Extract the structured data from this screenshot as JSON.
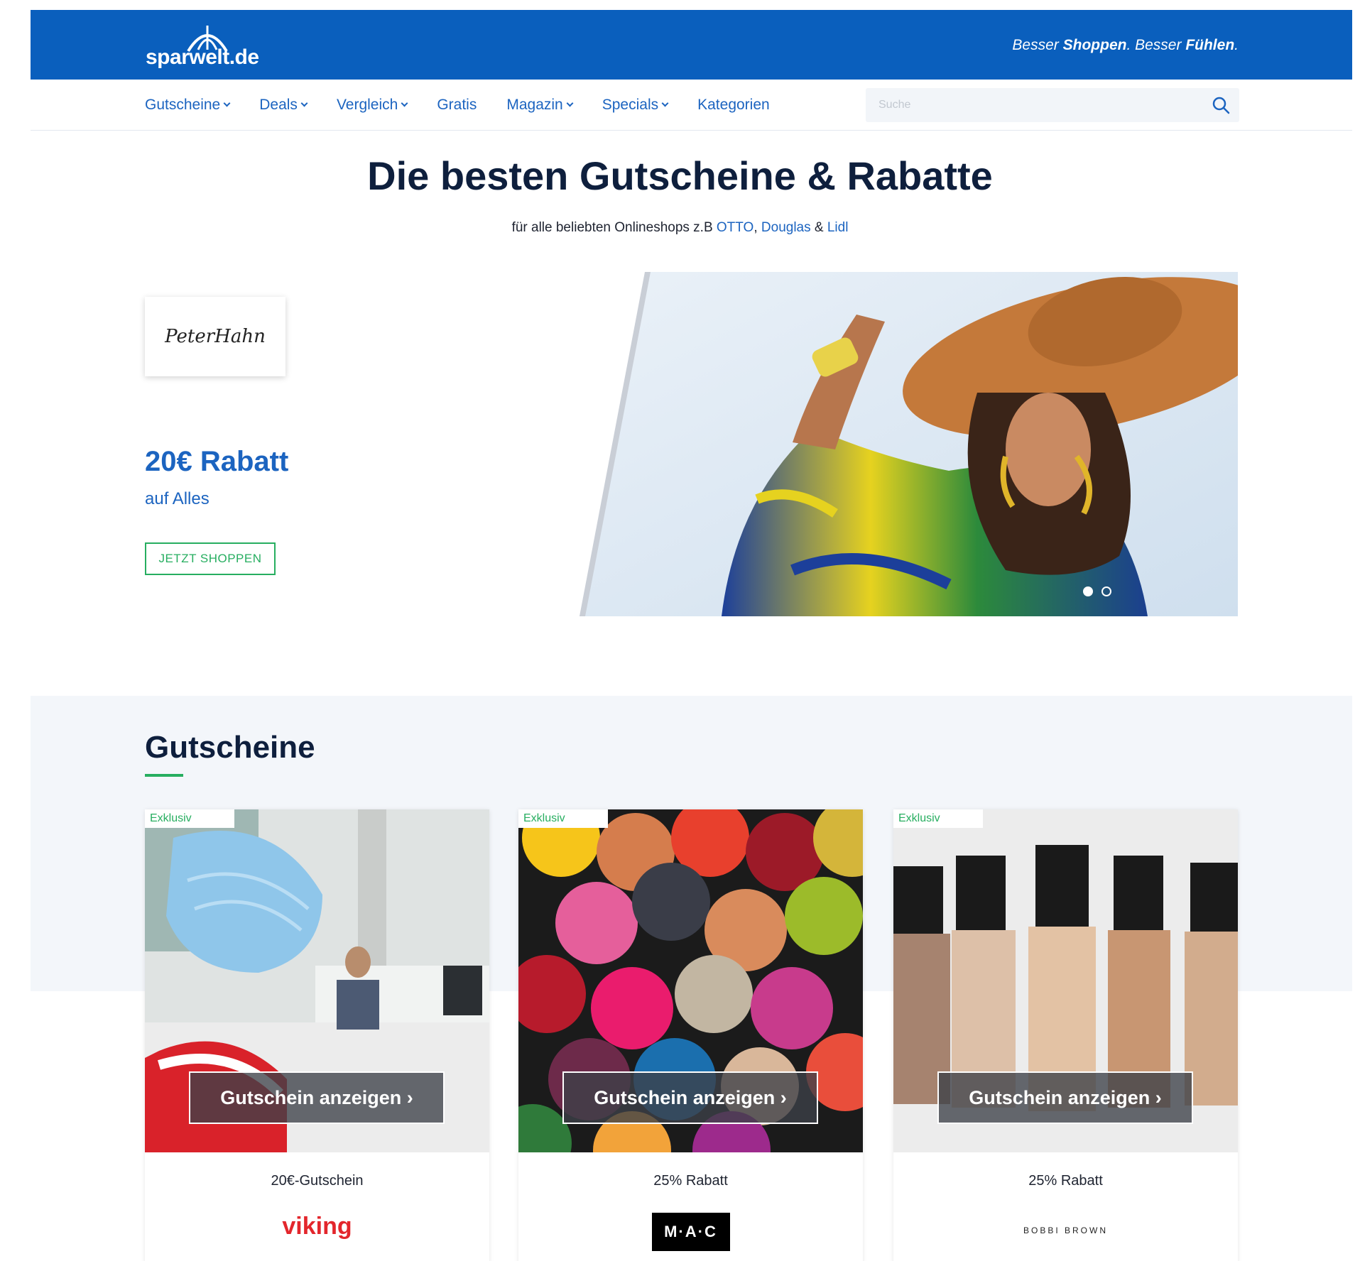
{
  "header": {
    "logo_text": "sparwelt.de",
    "tagline_1": "Besser ",
    "tagline_2": "Shoppen",
    "tagline_3": ". Besser ",
    "tagline_4": "Fühlen",
    "tagline_5": ".",
    "brand_color": "#0a5fbd"
  },
  "nav": {
    "items": [
      {
        "label": "Gutscheine",
        "dropdown": true
      },
      {
        "label": "Deals",
        "dropdown": true
      },
      {
        "label": "Vergleich",
        "dropdown": true
      },
      {
        "label": "Gratis",
        "dropdown": false
      },
      {
        "label": "Magazin",
        "dropdown": true
      },
      {
        "label": "Specials",
        "dropdown": true
      },
      {
        "label": "Kategorien",
        "dropdown": false
      }
    ],
    "search_placeholder": "Suche",
    "search_icon": "magnifier-icon"
  },
  "hero": {
    "title": "Die besten Gutscheine & Rabatte",
    "subtitle_prefix": "für alle beliebten Onlineshops z.B ",
    "link_otto": "OTTO",
    "sep1": ", ",
    "link_douglas": "Douglas",
    "sep2": " & ",
    "link_lidl": "Lidl",
    "shop_logo": "PeterHahn",
    "offer_title": "20€ Rabatt",
    "offer_subtitle": "auf Alles",
    "cta_label": "JETZT SHOPPEN",
    "slide_count": 2,
    "active_slide": 1
  },
  "section": {
    "title": "Gutscheine",
    "accent_color": "#27ae60"
  },
  "cards": [
    {
      "badge": "Exklusiv",
      "button": "Gutschein anzeigen ›",
      "title": "20€-Gutschein",
      "brand": "viking"
    },
    {
      "badge": "Exklusiv",
      "button": "Gutschein anzeigen ›",
      "title": "25% Rabatt",
      "brand": "M·A·C"
    },
    {
      "badge": "Exklusiv",
      "button": "Gutschein anzeigen ›",
      "title": "25% Rabatt",
      "brand": "BOBBI BROWN"
    }
  ]
}
